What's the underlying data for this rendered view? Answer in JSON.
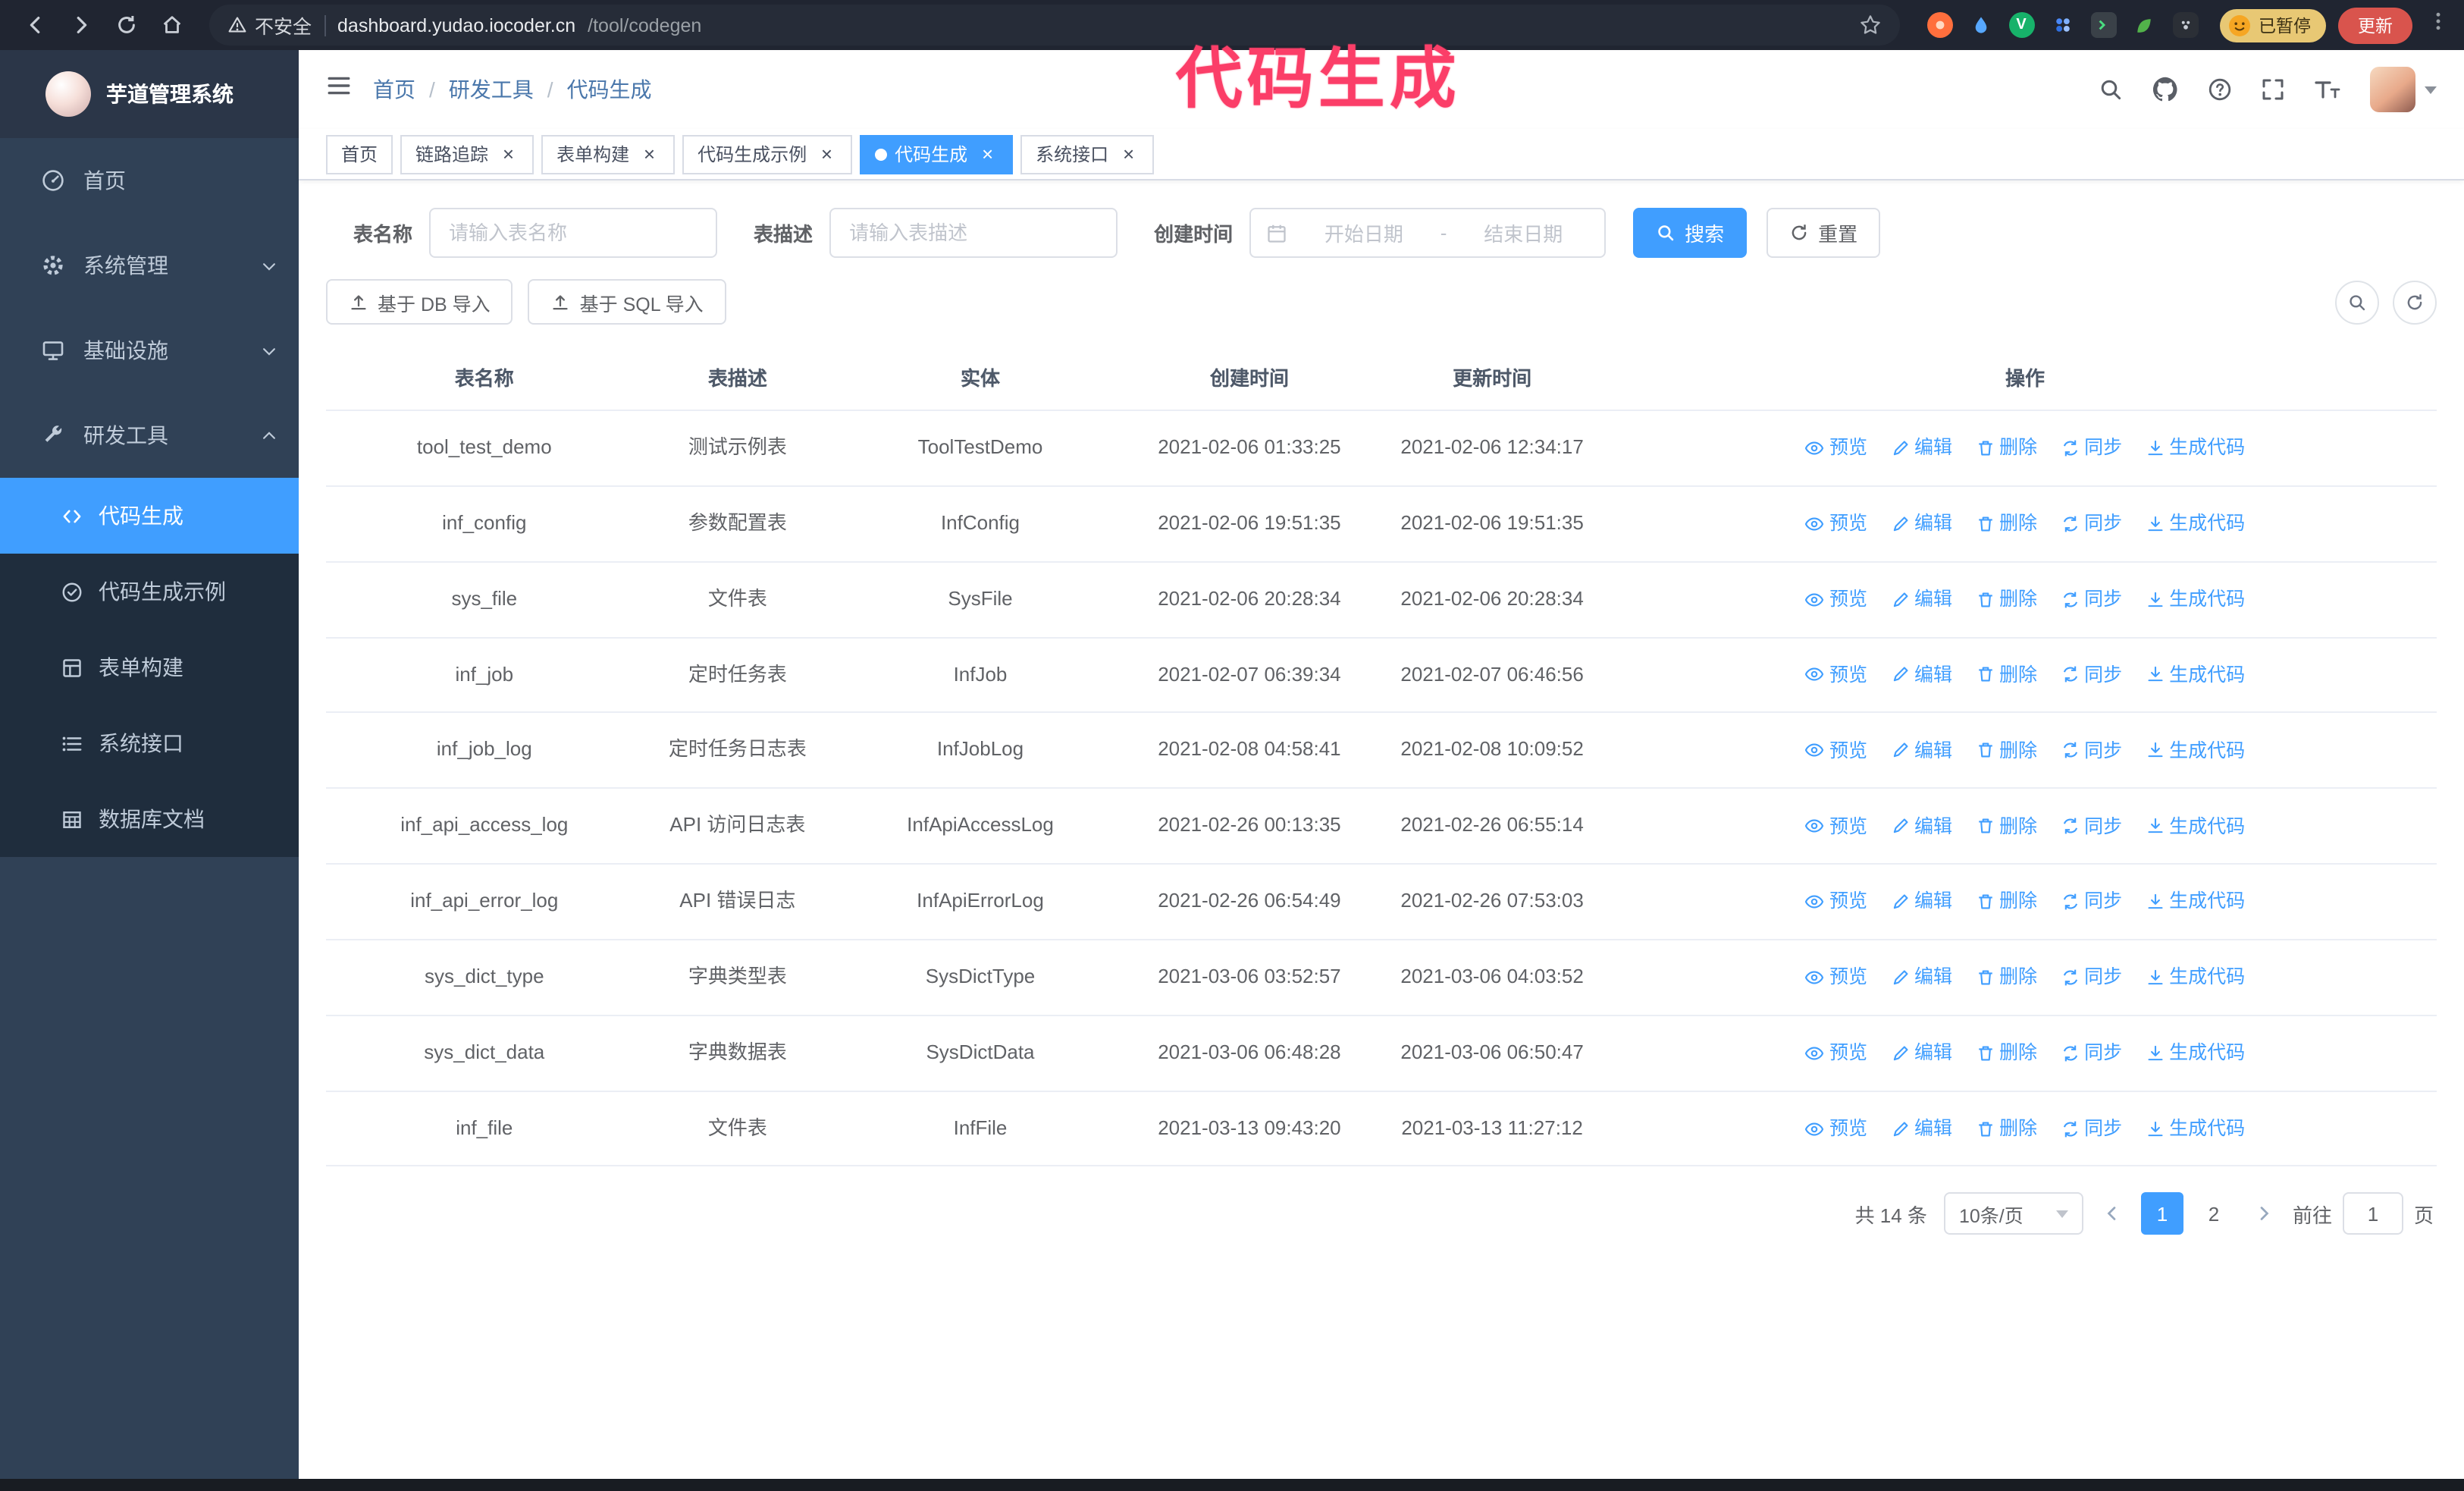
{
  "colors": {
    "accent": "#409eff",
    "sidebar": "#304156",
    "submenu": "#1f2d3d",
    "annotation": "#fb3e68",
    "update_button": "#d9544d",
    "paused_badge": "#e8c874"
  },
  "browser": {
    "security_label": "不安全",
    "url_host": "dashboard.yudao.iocoder.cn",
    "url_path": "/tool/codegen",
    "paused_badge": "已暂停",
    "update_button": "更新"
  },
  "annotation": {
    "text": "代码生成"
  },
  "sidebar": {
    "app_title": "芋道管理系统",
    "items": [
      {
        "label": "首页",
        "icon": "dashboard-icon"
      },
      {
        "label": "系统管理",
        "icon": "gear-icon"
      },
      {
        "label": "基础设施",
        "icon": "monitor-icon"
      },
      {
        "label": "研发工具",
        "icon": "tools-icon"
      }
    ],
    "subitems": [
      {
        "label": "代码生成",
        "icon": "code-icon",
        "active": true
      },
      {
        "label": "代码生成示例",
        "icon": "badge-check-icon"
      },
      {
        "label": "表单构建",
        "icon": "form-grid-icon"
      },
      {
        "label": "系统接口",
        "icon": "api-list-icon"
      },
      {
        "label": "数据库文档",
        "icon": "db-table-icon"
      }
    ]
  },
  "breadcrumb": {
    "items": [
      "首页",
      "研发工具",
      "代码生成"
    ],
    "separator": "/"
  },
  "tabs": [
    {
      "label": "首页",
      "closable": false,
      "active": false
    },
    {
      "label": "链路追踪",
      "closable": true,
      "active": false
    },
    {
      "label": "表单构建",
      "closable": true,
      "active": false
    },
    {
      "label": "代码生成示例",
      "closable": true,
      "active": false
    },
    {
      "label": "代码生成",
      "closable": true,
      "active": true
    },
    {
      "label": "系统接口",
      "closable": true,
      "active": false
    }
  ],
  "filters": {
    "name_label": "表名称",
    "name_placeholder": "请输入表名称",
    "desc_label": "表描述",
    "desc_placeholder": "请输入表描述",
    "time_label": "创建时间",
    "start_placeholder": "开始日期",
    "range_separator": "-",
    "end_placeholder": "结束日期",
    "search_button": "搜索",
    "reset_button": "重置"
  },
  "toolbar": {
    "import_db": "基于 DB 导入",
    "import_sql": "基于 SQL 导入"
  },
  "table": {
    "columns": [
      "表名称",
      "表描述",
      "实体",
      "创建时间",
      "更新时间",
      "操作"
    ],
    "actions": [
      "预览",
      "编辑",
      "删除",
      "同步",
      "生成代码"
    ],
    "rows": [
      {
        "name": "tool_test_demo",
        "desc": "测试示例表",
        "entity": "ToolTestDemo",
        "created": "2021-02-06 01:33:25",
        "updated": "2021-02-06 12:34:17"
      },
      {
        "name": "inf_config",
        "desc": "参数配置表",
        "entity": "InfConfig",
        "created": "2021-02-06 19:51:35",
        "updated": "2021-02-06 19:51:35"
      },
      {
        "name": "sys_file",
        "desc": "文件表",
        "entity": "SysFile",
        "created": "2021-02-06 20:28:34",
        "updated": "2021-02-06 20:28:34"
      },
      {
        "name": "inf_job",
        "desc": "定时任务表",
        "entity": "InfJob",
        "created": "2021-02-07 06:39:34",
        "updated": "2021-02-07 06:46:56"
      },
      {
        "name": "inf_job_log",
        "desc": "定时任务日志表",
        "entity": "InfJobLog",
        "created": "2021-02-08 04:58:41",
        "updated": "2021-02-08 10:09:52"
      },
      {
        "name": "inf_api_access_log",
        "desc": "API 访问日志表",
        "entity": "InfApiAccessLog",
        "created": "2021-02-26 00:13:35",
        "updated": "2021-02-26 06:55:14"
      },
      {
        "name": "inf_api_error_log",
        "desc": "API 错误日志",
        "entity": "InfApiErrorLog",
        "created": "2021-02-26 06:54:49",
        "updated": "2021-02-26 07:53:03"
      },
      {
        "name": "sys_dict_type",
        "desc": "字典类型表",
        "entity": "SysDictType",
        "created": "2021-03-06 03:52:57",
        "updated": "2021-03-06 04:03:52"
      },
      {
        "name": "sys_dict_data",
        "desc": "字典数据表",
        "entity": "SysDictData",
        "created": "2021-03-06 06:48:28",
        "updated": "2021-03-06 06:50:47"
      },
      {
        "name": "inf_file",
        "desc": "文件表",
        "entity": "InfFile",
        "created": "2021-03-13 09:43:20",
        "updated": "2021-03-13 11:27:12"
      }
    ]
  },
  "pagination": {
    "total_label": "共 14 条",
    "page_size": "10条/页",
    "pages": [
      "1",
      "2"
    ],
    "active_page": "1",
    "goto_prefix": "前往",
    "goto_value": "1",
    "goto_suffix": "页"
  }
}
